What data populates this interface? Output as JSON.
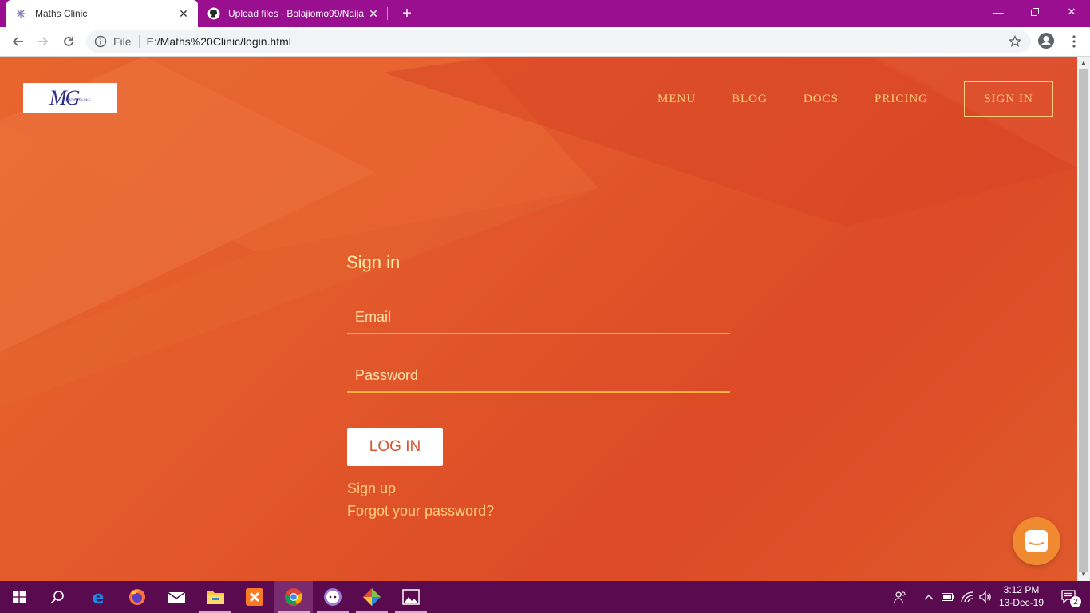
{
  "browser": {
    "tabs": [
      {
        "title": "Maths Clinic",
        "active": true
      },
      {
        "title": "Upload files · Bolajiomo99/Naija",
        "active": false
      }
    ],
    "address": {
      "scheme": "File",
      "url": "E:/Maths%20Clinic/login.html"
    },
    "tab_bar_color": "#9a0f8f"
  },
  "site": {
    "logo": {
      "text": "MG",
      "tagline": "MATHS CLINIC"
    },
    "nav": [
      "MENU",
      "BLOG",
      "DOCS",
      "PRICING"
    ],
    "sign_in_button": "SIGN IN",
    "accent_color": "#ffd079"
  },
  "form": {
    "title": "Sign in",
    "email_placeholder": "Email",
    "password_placeholder": "Password",
    "login_button": "LOG IN",
    "signup_link": "Sign up",
    "forgot_link": "Forgot your password?"
  },
  "taskbar": {
    "time": "3:12 PM",
    "date": "13-Dec-19",
    "notification_count": "2",
    "apps": [
      "start-icon",
      "search-icon",
      "edge-icon",
      "firefox-icon",
      "mail-icon",
      "file-explorer-icon",
      "xampp-icon",
      "chrome-icon",
      "github-desktop-icon",
      "git-icon",
      "photos-icon"
    ]
  }
}
